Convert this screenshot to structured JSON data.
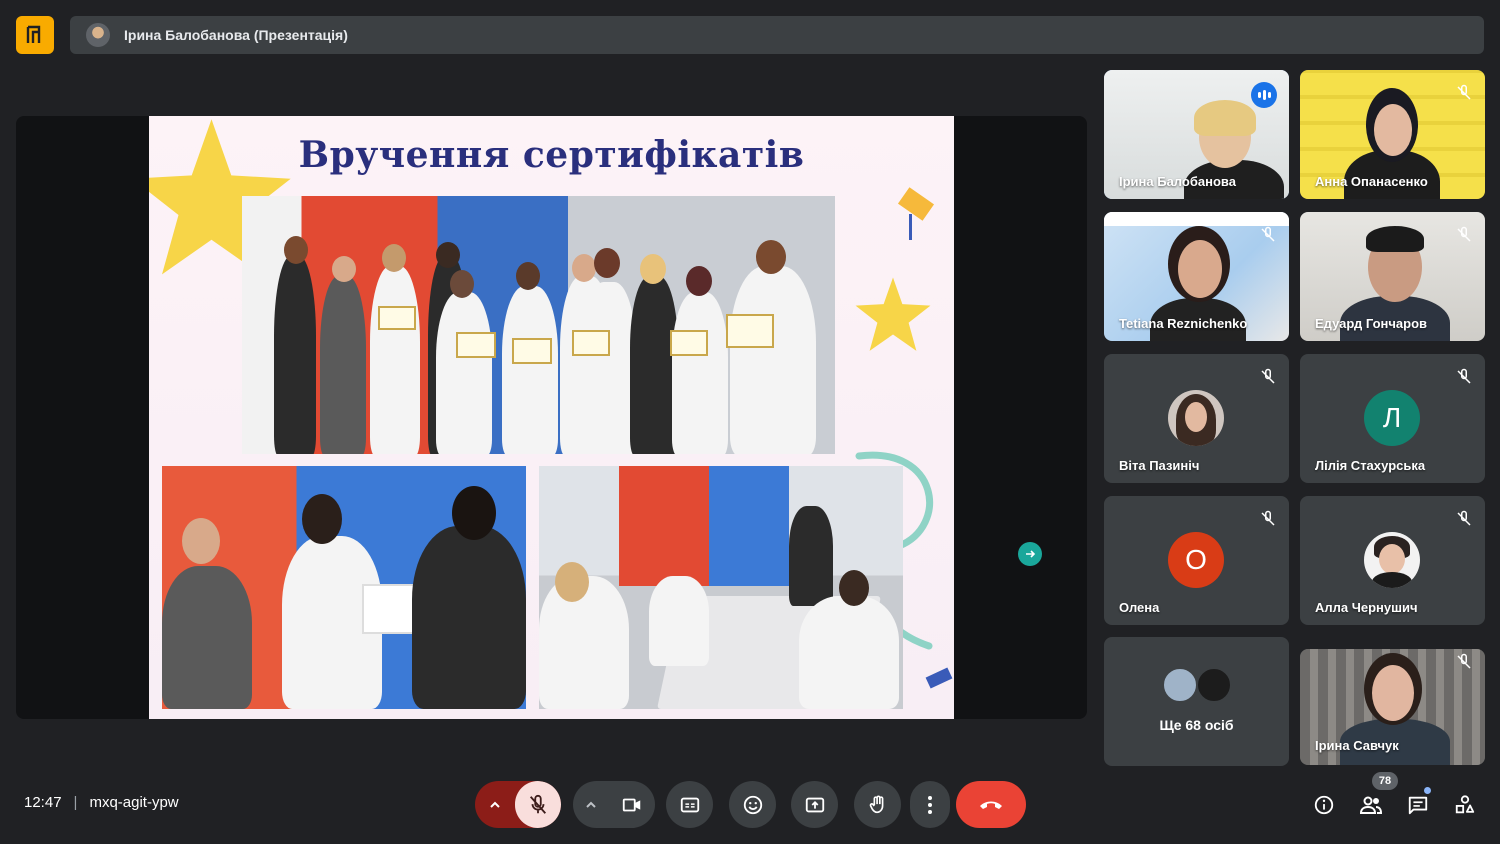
{
  "header": {
    "presenter_title": "Ірина Балобанова (Презентація)"
  },
  "slide": {
    "title": "Вручення сертифікатів"
  },
  "participants": [
    {
      "name": "Ірина Балобанова",
      "speaking": true
    },
    {
      "name": "Анна Опанасенко",
      "muted": true
    },
    {
      "name": "Tetiana Reznichenko",
      "muted": true
    },
    {
      "name": "Едуард Гончаров",
      "muted": true
    },
    {
      "name": "Віта Пазиніч",
      "muted": true
    },
    {
      "name": "Лілія Стахурська",
      "muted": true,
      "initial": "Л",
      "color": "#12826f"
    },
    {
      "name": "Олена",
      "muted": true,
      "initial": "О",
      "color": "#d93c16"
    },
    {
      "name": "Алла Чернушич",
      "muted": true
    },
    {
      "name": "Ірина Савчук",
      "muted": true
    }
  ],
  "more_people": {
    "label": "Ще 68 осіб"
  },
  "footer": {
    "time": "12:47",
    "meeting_code": "mxq-agit-ypw",
    "people_count": "78"
  },
  "colors": {
    "background": "#202124",
    "accent": "#8ab4f8",
    "end_call": "#ea4335",
    "mic_off_bg": "#f9dedc",
    "logo": "#f9ab00"
  },
  "icons": [
    "logo-icon",
    "chevron-up-icon",
    "mic-off-icon",
    "videocam-icon",
    "captions-icon",
    "emoji-icon",
    "present-icon",
    "raise-hand-icon",
    "more-vert-icon",
    "call-end-icon",
    "info-icon",
    "people-icon",
    "chat-icon",
    "activities-icon"
  ]
}
